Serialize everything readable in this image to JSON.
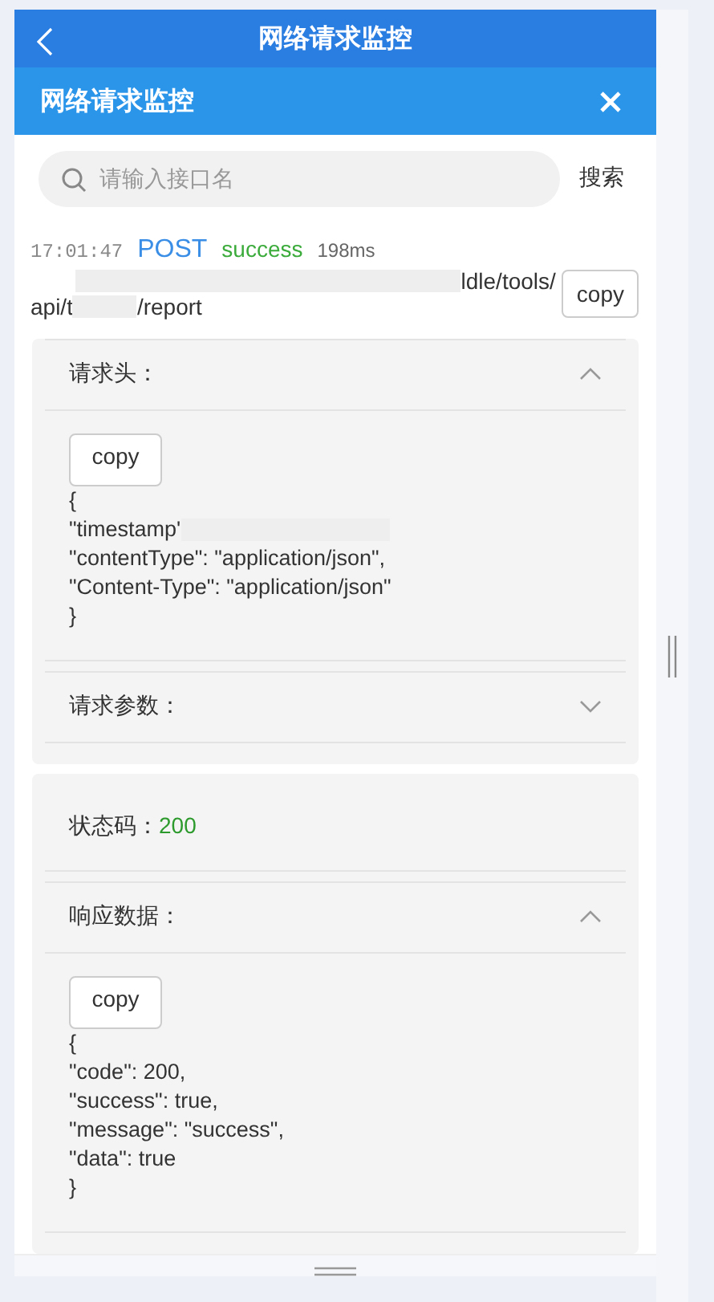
{
  "app_bar": {
    "title": "网络请求监控"
  },
  "panel": {
    "title": "网络请求监控"
  },
  "search": {
    "placeholder": "请输入接口名",
    "button": "搜索"
  },
  "request": {
    "time": "17:01:47",
    "method": "POST",
    "status": "success",
    "duration": "198ms",
    "url_lines": [
      "ldle/tools/",
      "api/t",
      "/report"
    ],
    "copy": "copy"
  },
  "cards": [
    {
      "sections": [
        {
          "kind": "collapsible",
          "label": "请求头：",
          "expanded": true,
          "copy": "copy",
          "lines": [
            "{",
            "\"timestamp'",
            "\"contentType\": \"application/json\",",
            "\"Content-Type\": \"application/json\"",
            "}"
          ]
        },
        {
          "kind": "collapsible",
          "label": "请求参数：",
          "expanded": false
        }
      ]
    },
    {
      "sections": [
        {
          "kind": "status",
          "label": "状态码：",
          "value": "200"
        },
        {
          "kind": "collapsible",
          "label": "响应数据：",
          "expanded": true,
          "copy": "copy",
          "lines": [
            "{",
            "\"code\": 200,",
            "\"success\": true,",
            "\"message\": \"success\",",
            "\"data\": true",
            "}"
          ]
        }
      ]
    }
  ]
}
